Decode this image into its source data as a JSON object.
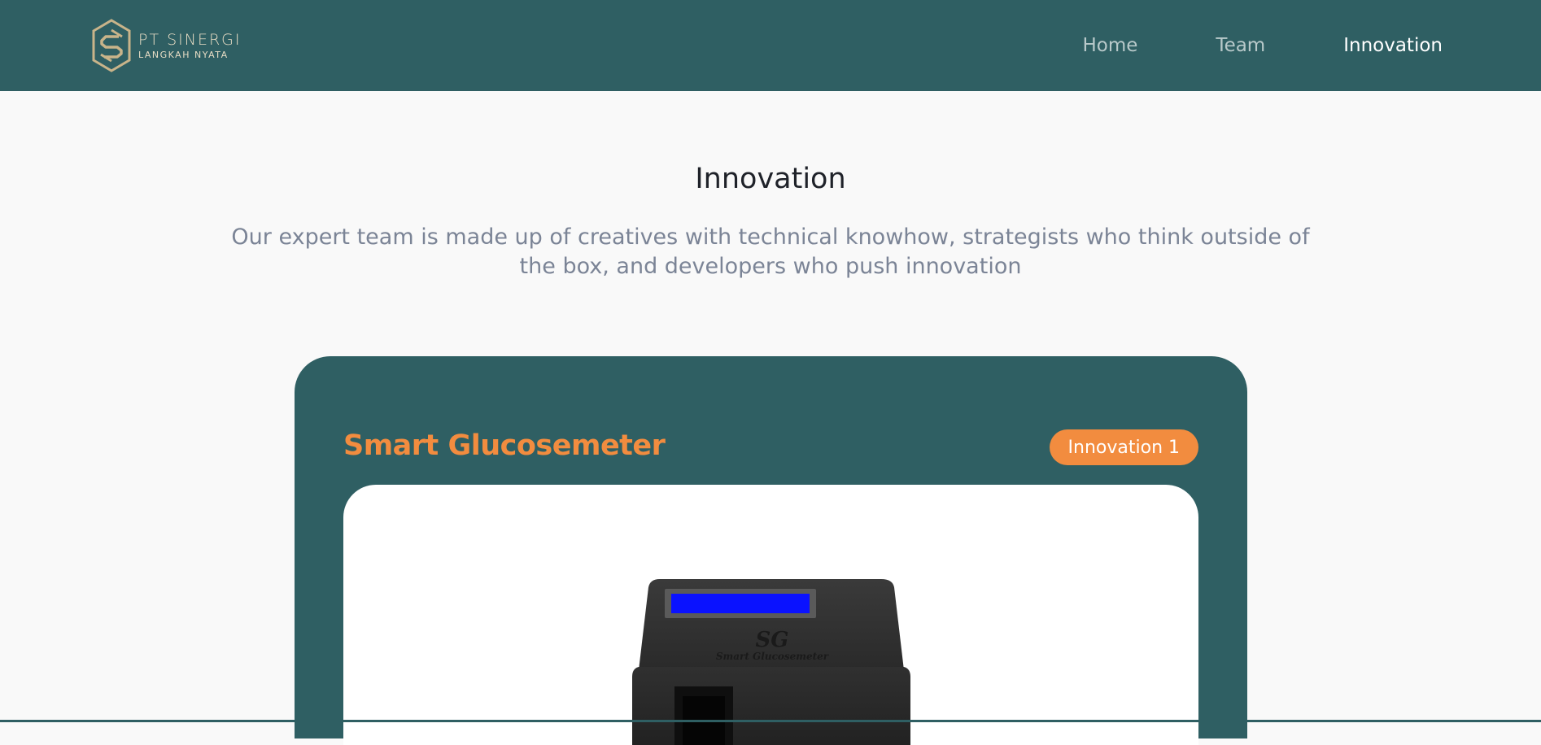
{
  "brand": {
    "line1": "PT SINERGI",
    "line2": "LANGKAH NYATA",
    "logo_icon": "hexagon-s-logo"
  },
  "nav": {
    "items": [
      {
        "label": "Home",
        "active": false
      },
      {
        "label": "Team",
        "active": false
      },
      {
        "label": "Innovation",
        "active": true
      }
    ]
  },
  "section": {
    "title": "Innovation",
    "subtitle": "Our expert team is made up of creatives with technical knowhow, strategists who think outside of the box, and developers who push innovation"
  },
  "card": {
    "title": "Smart Glucosemeter",
    "badge": "Innovation 1",
    "device_logo": "SG",
    "device_name": "Smart Glucosemeter"
  },
  "colors": {
    "primary": "#2f5f63",
    "accent": "#f28c3f",
    "background": "#f9f9f9",
    "screen": "#0a12ff"
  }
}
